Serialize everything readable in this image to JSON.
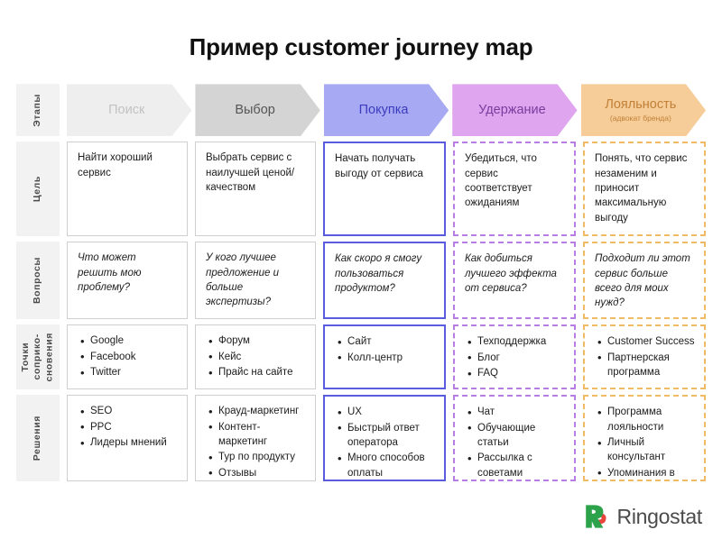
{
  "title": "Пример customer journey map",
  "stages_row_label": "Этапы",
  "stages": [
    {
      "label": "Поиск",
      "sub": "",
      "fill": "#eeeeee",
      "text": "#c2c2c2"
    },
    {
      "label": "Выбор",
      "sub": "",
      "fill": "#d4d4d4",
      "text": "#555555"
    },
    {
      "label": "Покупка",
      "sub": "",
      "fill": "#a7aaf2",
      "text": "#3b3bbf"
    },
    {
      "label": "Удержание",
      "sub": "",
      "fill": "#dfa5ef",
      "text": "#7b3b9e"
    },
    {
      "label": "Лояльность",
      "sub": "(адвокат бренда)",
      "fill": "#f6cd98",
      "text": "#c08038"
    }
  ],
  "cell_styles": [
    "solid-gray",
    "solid-gray",
    "solid-blue",
    "dashed-purple",
    "dashed-orange"
  ],
  "rows": [
    {
      "label": "Цель",
      "key": "row-goal",
      "type": "text",
      "cells": [
        "Найти хороший сервис",
        "Выбрать сервис с наилучшей ценой/качеством",
        "Начать получать выгоду от сервиса",
        "Убедиться, что сервис соответствует ожиданиям",
        "Понять, что сервис незаменим и приносит максимальную выгоду"
      ]
    },
    {
      "label": "Вопросы",
      "key": "row-quest",
      "type": "text-italic",
      "cells": [
        "Что может решить мою проблему?",
        "У кого лучшее предложение и больше экспертизы?",
        "Как скоро я смогу пользоваться продуктом?",
        "Как добиться лучшего эффекта от сервиса?",
        "Подходит ли этот сервис больше всего для моих нужд?"
      ]
    },
    {
      "label": "Точки\nсоприко-\nсновения",
      "key": "row-touch",
      "type": "list",
      "cells": [
        [
          "Google",
          "Facebook",
          "Twitter"
        ],
        [
          "Форум",
          "Кейс",
          "Прайс на сайте"
        ],
        [
          "Сайт",
          "Колл-центр"
        ],
        [
          "Техподдержка",
          "Блог",
          "FAQ"
        ],
        [
          "Customer Success",
          "Партнерская программа"
        ]
      ]
    },
    {
      "label": "Решения",
      "key": "row-sol",
      "type": "list",
      "cells": [
        [
          "SEO",
          "PPC",
          "Лидеры мнений"
        ],
        [
          "Крауд-маркетинг",
          "Контент-маркетинг",
          "Тур по продукту",
          "Отзывы"
        ],
        [
          "UX",
          "Быстрый ответ оператора",
          "Много способов оплаты"
        ],
        [
          "Чат",
          "Обучающие статьи",
          "Рассылка с советами"
        ],
        [
          "Программа лояльности",
          "Личный консультант",
          "Упоминания в СМИ"
        ]
      ]
    }
  ],
  "logo": {
    "text": "Ringostat",
    "green": "#2ca24a",
    "red": "#e8453c"
  }
}
